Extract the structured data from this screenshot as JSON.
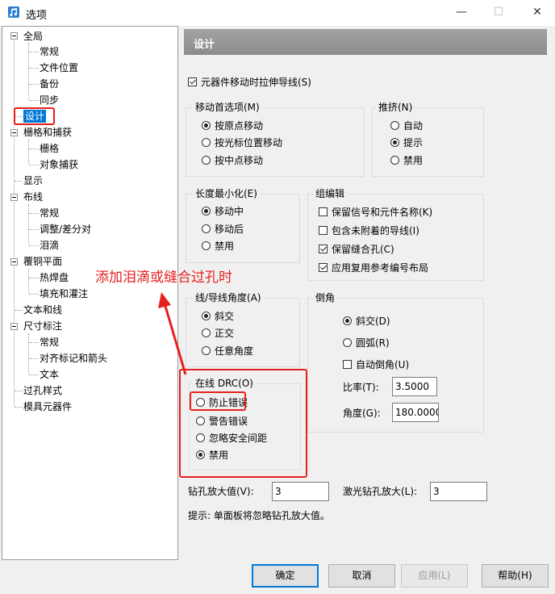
{
  "window": {
    "title": "选项",
    "minimize": "—",
    "maximize": "☐",
    "close": "✕"
  },
  "tree": [
    {
      "label": "全局",
      "level": 0,
      "expanded": true
    },
    {
      "label": "常规",
      "level": 1
    },
    {
      "label": "文件位置",
      "level": 1
    },
    {
      "label": "备份",
      "level": 1
    },
    {
      "label": "同步",
      "level": 1
    },
    {
      "label": "设计",
      "level": 0,
      "selected": true
    },
    {
      "label": "栅格和捕获",
      "level": 0,
      "expanded": true
    },
    {
      "label": "栅格",
      "level": 1
    },
    {
      "label": "对象捕获",
      "level": 1
    },
    {
      "label": "显示",
      "level": 0
    },
    {
      "label": "布线",
      "level": 0,
      "expanded": true
    },
    {
      "label": "常规",
      "level": 1
    },
    {
      "label": "调整/差分对",
      "level": 1
    },
    {
      "label": "泪滴",
      "level": 1
    },
    {
      "label": "覆铜平面",
      "level": 0,
      "expanded": true
    },
    {
      "label": "热焊盘",
      "level": 1
    },
    {
      "label": "填充和灌注",
      "level": 1
    },
    {
      "label": "文本和线",
      "level": 0
    },
    {
      "label": "尺寸标注",
      "level": 0,
      "expanded": true
    },
    {
      "label": "常规",
      "level": 1
    },
    {
      "label": "对齐标记和箭头",
      "level": 1
    },
    {
      "label": "文本",
      "level": 1
    },
    {
      "label": "过孔样式",
      "level": 0
    },
    {
      "label": "模具元器件",
      "level": 0
    }
  ],
  "panel": {
    "title": "设计",
    "stretch_traces": {
      "label": "元器件移动时拉伸导线(S)",
      "checked": true
    },
    "move_pref": {
      "legend": "移动首选项(M)",
      "options": [
        {
          "label": "按原点移动",
          "checked": true
        },
        {
          "label": "按光标位置移动",
          "checked": false
        },
        {
          "label": "按中点移动",
          "checked": false
        }
      ]
    },
    "push": {
      "legend": "推挤(N)",
      "options": [
        {
          "label": "自动",
          "checked": false
        },
        {
          "label": "提示",
          "checked": true
        },
        {
          "label": "禁用",
          "checked": false
        }
      ]
    },
    "length_min": {
      "legend": "长度最小化(E)",
      "options": [
        {
          "label": "移动中",
          "checked": true
        },
        {
          "label": "移动后",
          "checked": false
        },
        {
          "label": "禁用",
          "checked": false
        }
      ]
    },
    "group_edit": {
      "legend": "组编辑",
      "options": [
        {
          "label": "保留信号和元件名称(K)",
          "checked": false
        },
        {
          "label": "包含未附着的导线(I)",
          "checked": false
        },
        {
          "label": "保留缝合孔(C)",
          "checked": true
        },
        {
          "label": "应用复用参考编号布局",
          "checked": true
        }
      ]
    },
    "line_angle": {
      "legend": "线/导线角度(A)",
      "options": [
        {
          "label": "斜交",
          "checked": true
        },
        {
          "label": "正交",
          "checked": false
        },
        {
          "label": "任意角度",
          "checked": false
        }
      ]
    },
    "chamfer": {
      "legend": "倒角",
      "options": [
        {
          "label": "斜交(D)",
          "checked": true
        },
        {
          "label": "圆弧(R)",
          "checked": false
        }
      ],
      "auto_label": "自动倒角(U)",
      "auto_checked": false,
      "ratio_label": "比率(T):",
      "ratio_value": "3.5000",
      "angle_label": "角度(G):",
      "angle_value": "180.0000"
    },
    "online_drc": {
      "legend": "在线 DRC(O)",
      "options": [
        {
          "label": "防止错误",
          "checked": false
        },
        {
          "label": "警告错误",
          "checked": false
        },
        {
          "label": "忽略安全间距",
          "checked": false
        },
        {
          "label": "禁用",
          "checked": true
        }
      ]
    },
    "drill_oversize": {
      "label": "钻孔放大值(V):",
      "value": "3"
    },
    "laser_oversize": {
      "label": "激光钻孔放大(L):",
      "value": "3"
    },
    "hint": "提示:  单面板将忽略钻孔放大值。"
  },
  "buttons": {
    "ok": "确定",
    "cancel": "取消",
    "apply": "应用(L)",
    "help": "帮助(H)"
  },
  "annotation": {
    "text": "添加泪滴或缝合过孔时",
    "color": "#e62020"
  }
}
